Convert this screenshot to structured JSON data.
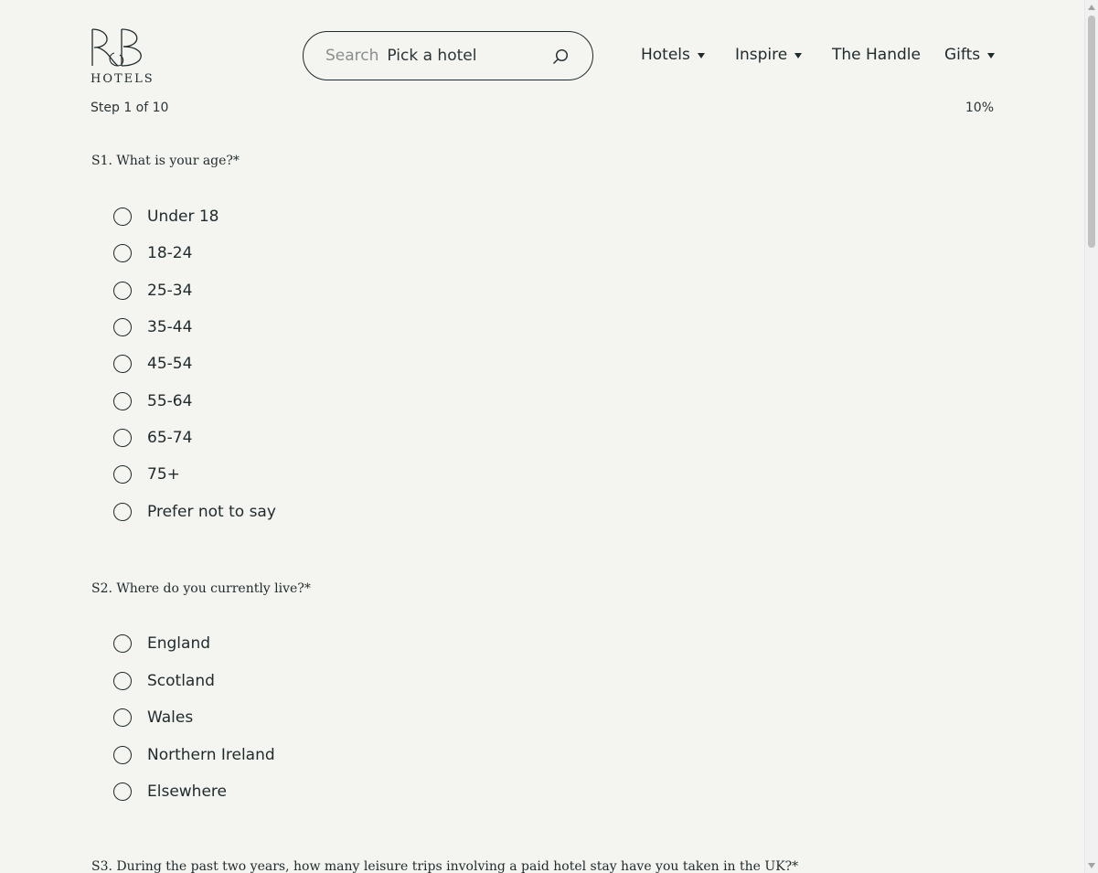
{
  "brand": {
    "logo_mark": "RB",
    "logo_text": "HOTELS"
  },
  "search": {
    "label": "Search",
    "value": "Pick a hotel",
    "icon": "search-icon"
  },
  "nav": {
    "items": [
      {
        "label": "Hotels",
        "has_dropdown": true
      },
      {
        "label": "Inspire",
        "has_dropdown": true
      },
      {
        "label": "The Handle",
        "has_dropdown": false
      },
      {
        "label": "Gifts",
        "has_dropdown": true
      }
    ]
  },
  "progress": {
    "step_text": "Step 1 of 10",
    "percent_text": "10%",
    "percent": 10
  },
  "questions": [
    {
      "text": "S1. What is your age?*",
      "options": [
        "Under 18",
        "18-24",
        "25-34",
        "35-44",
        "45-54",
        "55-64",
        "65-74",
        "75+",
        "Prefer not to say"
      ]
    },
    {
      "text": "S2. Where do you currently live?*",
      "options": [
        "England",
        "Scotland",
        "Wales",
        "Northern Ireland",
        "Elsewhere"
      ]
    },
    {
      "text": "S3. During the past two years, how many leisure trips involving a paid hotel stay have you taken in the UK?*",
      "options": []
    }
  ],
  "colors": {
    "background": "#f4f4f0",
    "text": "#1f2a2c",
    "muted": "#8a8e8c"
  }
}
